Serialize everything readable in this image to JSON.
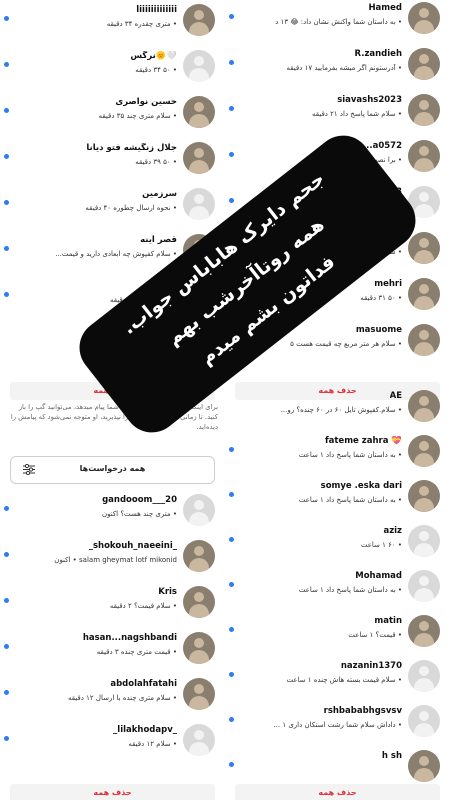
{
  "left_top": [
    {
      "name": "liiiiiiiiiiiii",
      "msg": "• متری چقدره ۳۴ دقیقه",
      "photo": true,
      "dot": true
    },
    {
      "name": "نرگس🌞🤍",
      "msg": "• ۵۰ ۳۴ دقیقه",
      "photo": false,
      "dot": true
    },
    {
      "name": "حسین نواصری",
      "msg": "• سلام متری چند ۳۵ دقیقه",
      "photo": true,
      "dot": true
    },
    {
      "name": "جلال زنگیشه فتو دیانا",
      "msg": "• ۵۰ ۳۹ دقیقه",
      "photo": true,
      "dot": true
    },
    {
      "name": "سرزمین",
      "msg": "• نحوه ارسال چطوره ۴۰ دقیقه",
      "photo": false,
      "dot": true
    },
    {
      "name": "قصر آینه",
      "msg": "• سلام کفپوش چه ابعادی دارید و قیمت...",
      "photo": true,
      "dot": true
    },
    {
      "name": "",
      "msg": "شما پاسخ داد ۶۰ دقیقه",
      "photo": false,
      "dot": true
    }
  ],
  "left_delete_top": "حذف همه",
  "notice": "برای اینکه بفهمید چه کسی داره به شما پیام میدهد، می‌توانید گپ را باز کنید. تا زمانی‌که درخواست پیام را نپذیرید، او متوجه نمی‌شود که پیامش را دیده‌اید.",
  "all_requests": "همه درخواست‌ها",
  "left_bottom": [
    {
      "name": "gandooom___20",
      "msg": "• متری چند هست؟ اکنون",
      "photo": false,
      "dot": true
    },
    {
      "name": "_shokouh_naeeini_",
      "msg": "salam gheymat lotf mikonid • اکنون",
      "photo": true,
      "dot": true
    },
    {
      "name": "Kris",
      "msg": "• سلام قیمت؟ ۲ دقیقه",
      "photo": true,
      "dot": true
    },
    {
      "name": "hasan...nagshbandi",
      "msg": "• قیمت متری چنده ۳ دقیقه",
      "photo": true,
      "dot": true
    },
    {
      "name": "abdolahfatahi",
      "msg": "• سلام متری چنده با ارسال ۱۲ دقیقه",
      "photo": true,
      "dot": true
    },
    {
      "name": "_lilakhodapv_",
      "msg": "• سلام ۱۲ دقیقه",
      "photo": false,
      "dot": true
    }
  ],
  "left_delete_bottom": "حذف همه",
  "right_top": [
    {
      "name": "Hamed",
      "msg": "• به داستان شما واکنش نشان داد: 😂 ۱۳ د",
      "photo": true,
      "dot": true
    },
    {
      "name": "R.zandieh",
      "msg": "• آدرستونم اگر میشه بفرمایید ۱۷ دقیقه",
      "photo": true,
      "dot": true
    },
    {
      "name": "siavashs2023",
      "msg": "• سلام شما پاسخ داد ۲۱ دقیقه",
      "photo": true,
      "dot": true
    },
    {
      "name": "...a0572",
      "msg": "• برا نصب ... کنید؟ ۲۳",
      "photo": true,
      "dot": true
    },
    {
      "name": "...i1343",
      "msg": "• سلام ...",
      "photo": false,
      "dot": true
    },
    {
      "name": "...sem nemati",
      "msg": "• شماره تماس ...",
      "photo": true,
      "dot": true
    },
    {
      "name": "mehri",
      "msg": "• ۵۰ ۳۱ دقیقه",
      "photo": true,
      "dot": true
    },
    {
      "name": "masuome",
      "msg": "• سلام هر متر مربع چه قیمت هست ۵",
      "photo": true,
      "dot": true
    }
  ],
  "right_delete_top": "حذف همه",
  "right_bottom": [
    {
      "name": "AE",
      "msg": "• سلام.کفپوش تایل ۶۰ در ۶۰ چنده؟ رو...",
      "photo": true,
      "dot": false
    },
    {
      "name": "fateme zahra 💝",
      "msg": "• به داستان شما پاسخ داد ۱ ساعت",
      "photo": true,
      "dot": true
    },
    {
      "name": "somye .eska dari",
      "msg": "• به داستان شما پاسخ داد ۱ ساعت",
      "photo": true,
      "dot": true
    },
    {
      "name": "aziz",
      "msg": "• ۶۰ ۱ ساعت",
      "photo": false,
      "dot": true
    },
    {
      "name": "Mohamad",
      "msg": "• به داستان شما پاسخ داد ۱ ساعت",
      "photo": false,
      "dot": true
    },
    {
      "name": "matin",
      "msg": "• قیمت؟ ۱ ساعت",
      "photo": true,
      "dot": true
    },
    {
      "name": "nazanin1370",
      "msg": "• سلام قیمت بسته هاش چنده ۱ ساعت",
      "photo": false,
      "dot": true
    },
    {
      "name": "rshbababhgsvsv",
      "msg": "• داداش سلام شما رشت استکان داری ۱ ...",
      "photo": false,
      "dot": true
    },
    {
      "name": "h sh",
      "msg": "",
      "photo": true,
      "dot": true
    }
  ],
  "right_delete_bottom": "حذف همه",
  "overlay_lines": [
    "جحم دایرک هاباباس جواب.",
    "همه روتاآخرشب بهم",
    "فداتون بشم میدم"
  ],
  "colors": {
    "unread_dot": "#2e7df0",
    "delete": "#e0303a",
    "banner": "#0a0a0a"
  }
}
